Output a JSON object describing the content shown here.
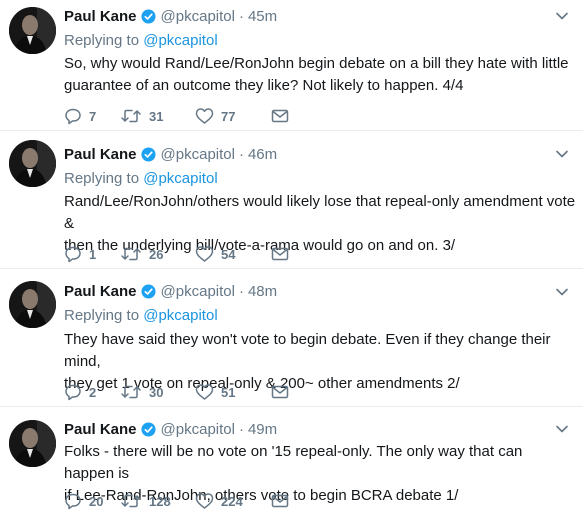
{
  "tweets": [
    {
      "name": "Paul Kane",
      "handle": "@pkcapitol",
      "time": "45m",
      "reply_label": "Replying to",
      "reply_mention": "@pkcapitol",
      "text": "So, why would Rand/Lee/RonJohn begin debate on a bill they hate with little\nguarantee of an outcome they like? Not likely to happen. 4/4",
      "replies": "7",
      "retweets": "31",
      "likes": "77"
    },
    {
      "name": "Paul Kane",
      "handle": "@pkcapitol",
      "time": "46m",
      "reply_label": "Replying to",
      "reply_mention": "@pkcapitol",
      "text": "Rand/Lee/RonJohn/others would likely lose that repeal-only amendment vote &\nthen the underlying bill/vote-a-rama would go on and on. 3/",
      "replies": "1",
      "retweets": "26",
      "likes": "54"
    },
    {
      "name": "Paul Kane",
      "handle": "@pkcapitol",
      "time": "48m",
      "reply_label": "Replying to",
      "reply_mention": "@pkcapitol",
      "text": "They have said they won't vote to begin debate. Even if they change their mind,\nthey get 1 vote on repeal-only & 200~ other amendments 2/",
      "replies": "2",
      "retweets": "30",
      "likes": "51"
    },
    {
      "name": "Paul Kane",
      "handle": "@pkcapitol",
      "time": "49m",
      "text": "Folks - there will be no vote on '15 repeal-only. The only way that can happen is\nif Lee-Rand-RonJohn, others vote to begin BCRA debate 1/",
      "replies": "20",
      "retweets": "128",
      "likes": "224"
    }
  ],
  "separator": "·",
  "icons": {
    "verified": "verified-badge-icon",
    "caret": "chevron-down-icon",
    "reply": "reply-icon",
    "retweet": "retweet-icon",
    "like": "heart-icon",
    "dm": "envelope-icon"
  },
  "colors": {
    "text": "#14171a",
    "secondary": "#657786",
    "link": "#1b95e0",
    "verified": "#1da1f2",
    "divider": "#e6ecf0"
  }
}
